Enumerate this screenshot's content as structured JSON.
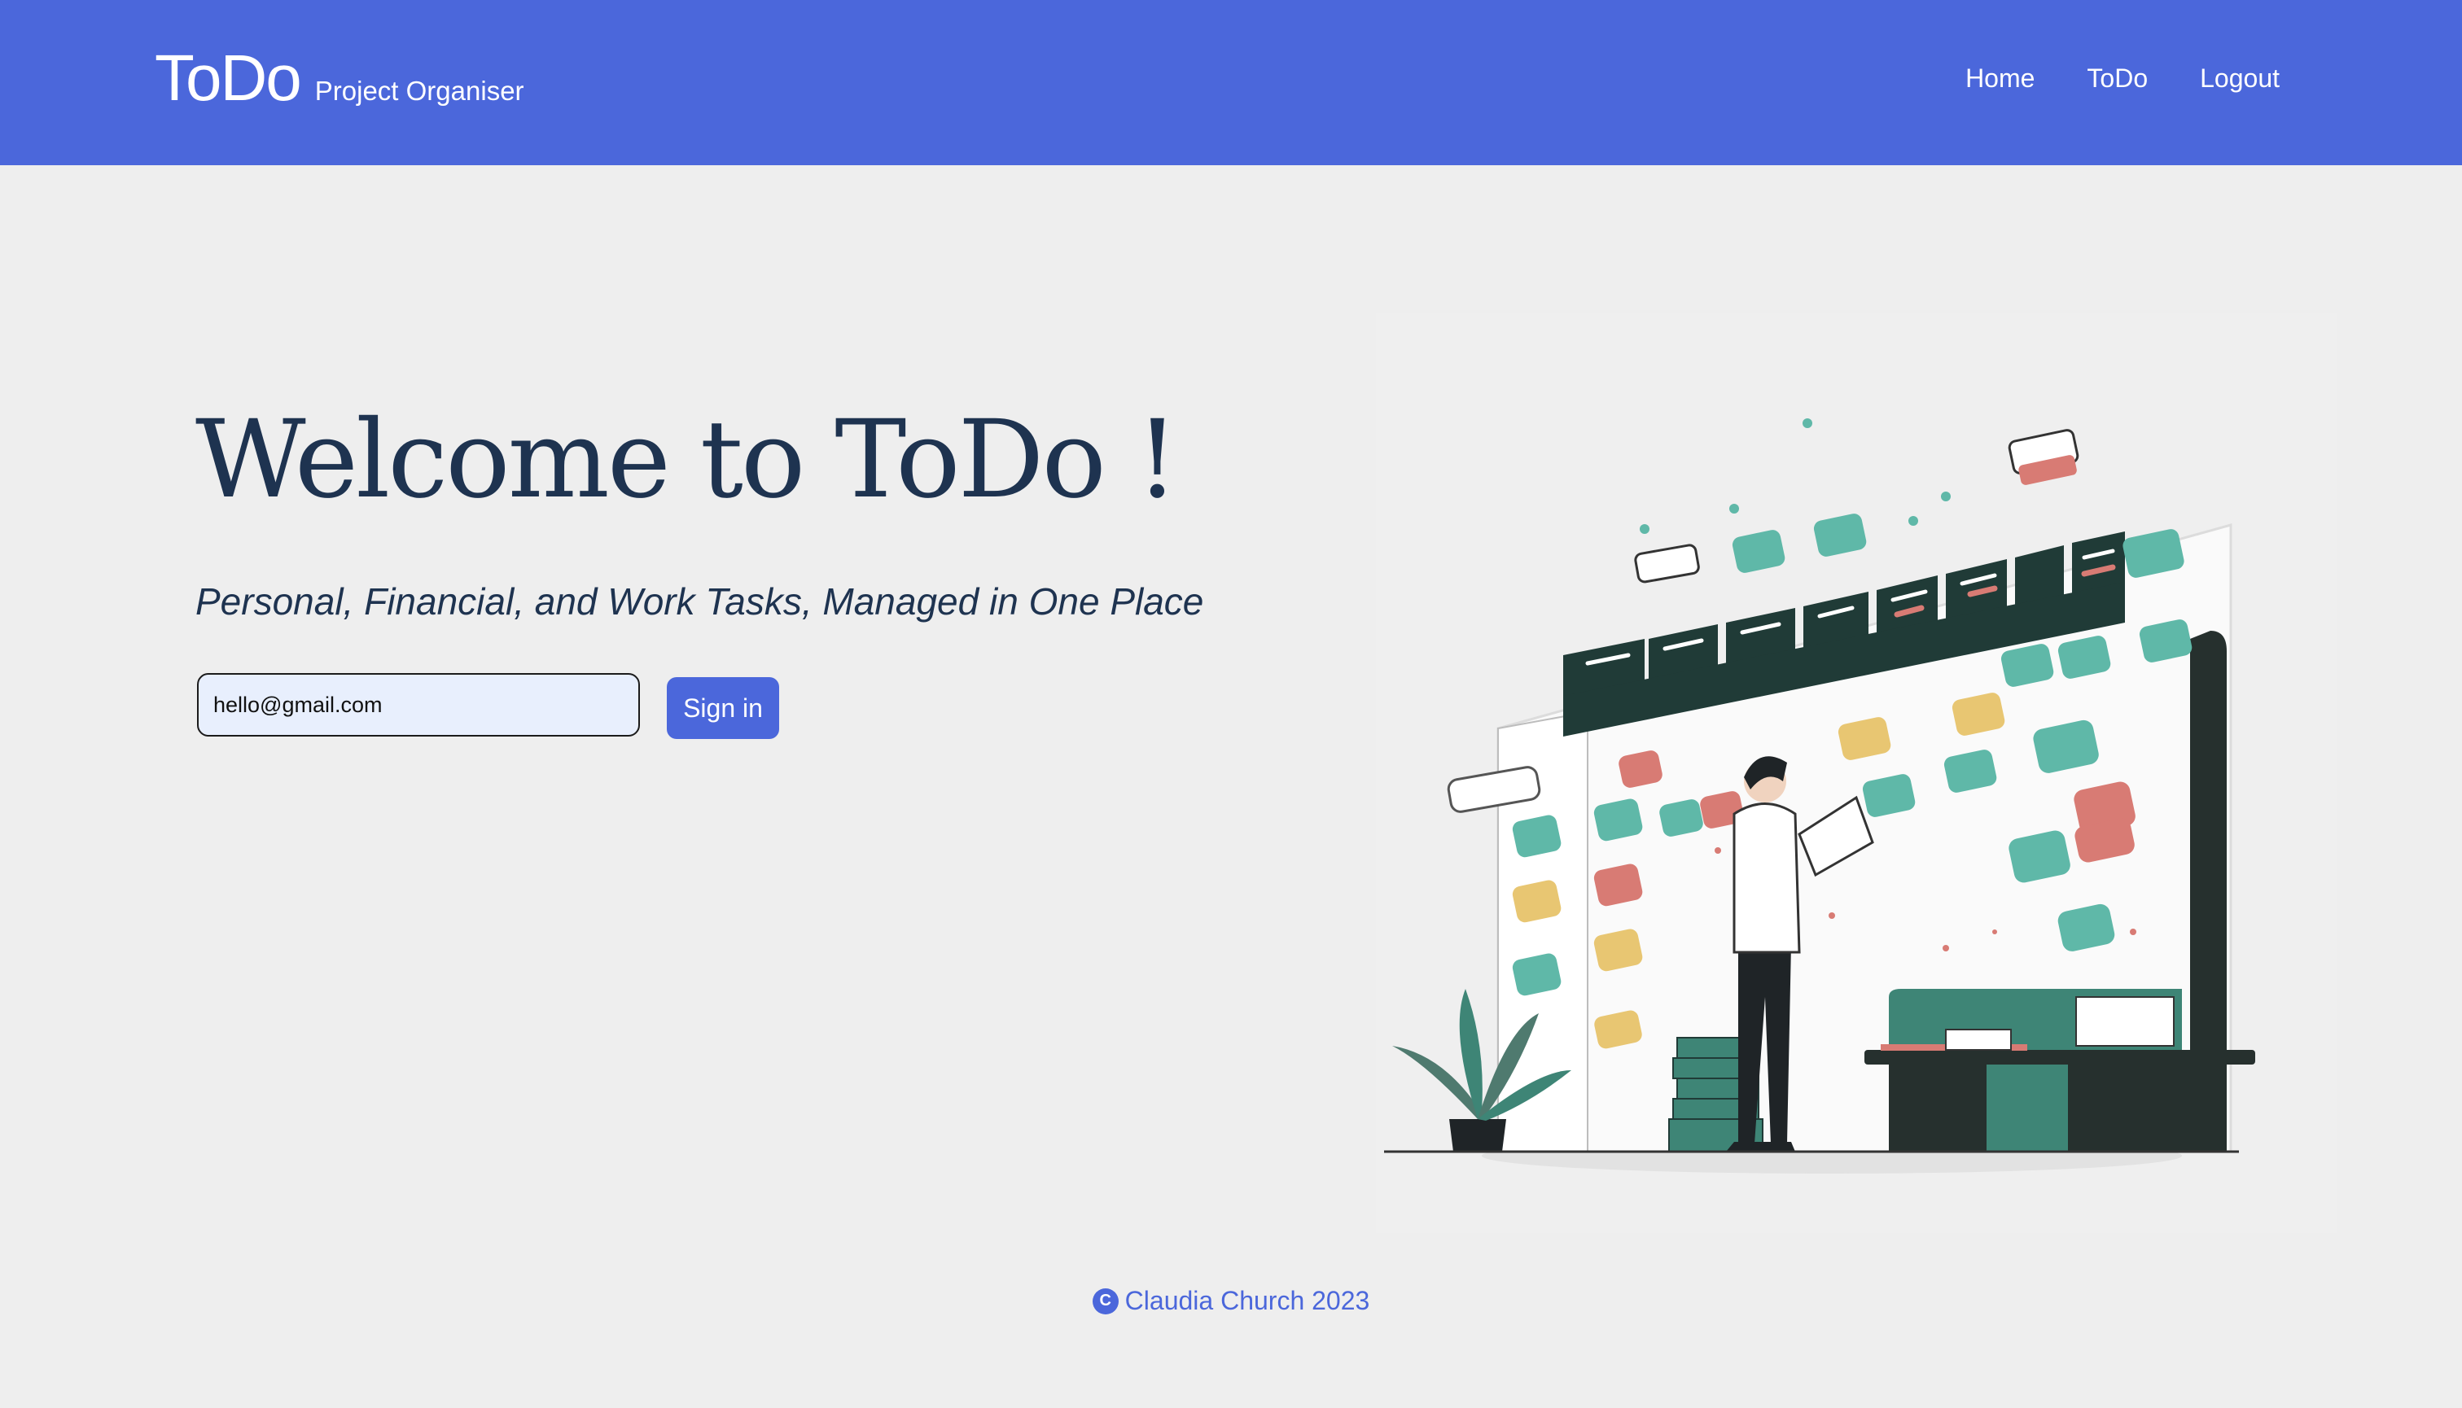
{
  "header": {
    "brand_title": "ToDo",
    "brand_subtitle": "Project Organiser",
    "nav": [
      {
        "label": "Home"
      },
      {
        "label": "ToDo"
      },
      {
        "label": "Logout"
      }
    ]
  },
  "hero": {
    "title": "Welcome to ToDo !",
    "subtitle": "Personal, Financial, and Work Tasks, Managed in One Place",
    "email_value": "hello@gmail.com",
    "sign_in_label": "Sign in"
  },
  "footer": {
    "icon": "copyright-icon",
    "icon_glyph": "C",
    "text": "Claudia Church 2023"
  },
  "colors": {
    "brand": "#4b67db",
    "background": "#eeeeee",
    "heading": "#1e3350",
    "teal": "#5fb8a8",
    "coral": "#d87b74",
    "mustard": "#e8c672",
    "dark_green": "#203b37"
  },
  "illustration": {
    "icon": "kanban-board-illustration"
  }
}
